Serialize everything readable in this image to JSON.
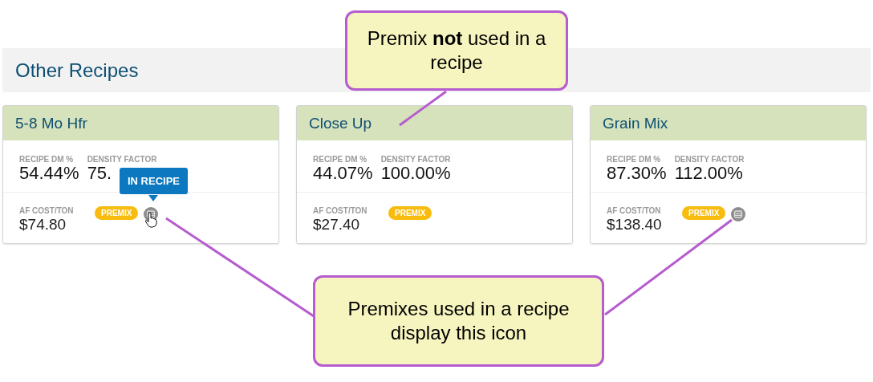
{
  "section": {
    "title": "Other Recipes"
  },
  "recipes": [
    {
      "name": "5-8 Mo Hfr",
      "dm_label": "RECIPE DM %",
      "dm": "54.44%",
      "density_label": "DENSITY FACTOR",
      "density": "75.",
      "cost_label": "AF COST/TON",
      "cost": "$74.80",
      "badge": "PREMIX",
      "in_recipe": true,
      "tooltip": "IN RECIPE"
    },
    {
      "name": "Close Up",
      "dm_label": "RECIPE DM %",
      "dm": "44.07%",
      "density_label": "DENSITY FACTOR",
      "density": "100.00%",
      "cost_label": "AF COST/TON",
      "cost": "$27.40",
      "badge": "PREMIX",
      "in_recipe": false
    },
    {
      "name": "Grain Mix",
      "dm_label": "RECIPE DM %",
      "dm": "87.30%",
      "density_label": "DENSITY FACTOR",
      "density": "112.00%",
      "cost_label": "AF COST/TON",
      "cost": "$138.40",
      "badge": "PREMIX",
      "in_recipe": true
    }
  ],
  "callouts": [
    {
      "text": "Premix **not** used in a recipe"
    },
    {
      "text": "Premixes used in a recipe display this icon"
    }
  ]
}
